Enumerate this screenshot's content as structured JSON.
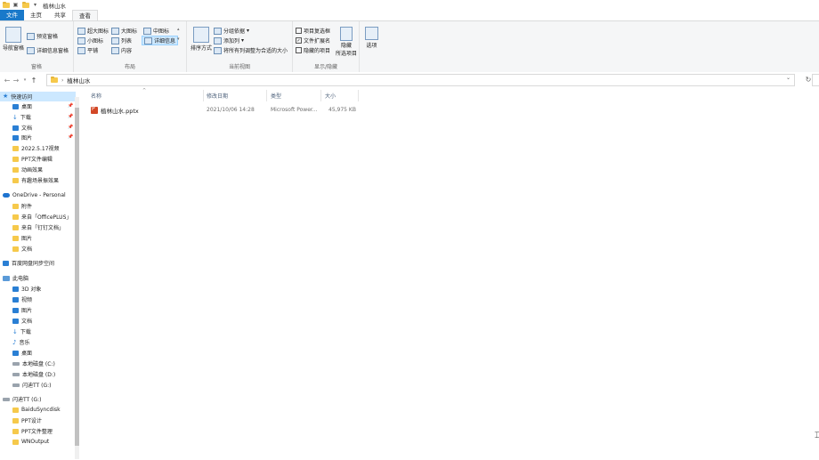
{
  "window": {
    "title": "植林山水"
  },
  "tabs": [
    {
      "label": "文件"
    },
    {
      "label": "主页"
    },
    {
      "label": "共享"
    },
    {
      "label": "查看"
    }
  ],
  "ribbon": {
    "panes": {
      "nav_pane": "导航窗格",
      "preview": "预览窗格",
      "details": "详细信息窗格",
      "label": "窗格"
    },
    "layout": {
      "xl_icons": "超大图标",
      "large_icons": "大图标",
      "medium_icons": "中图标",
      "small_icons": "小图标",
      "list": "列表",
      "details": "详细信息",
      "tiles": "平铺",
      "content": "内容",
      "label": "布局"
    },
    "current_view": {
      "sort": "排序方式",
      "group_by": "分组依据",
      "add_columns": "添加列",
      "size_all": "将所有列调整为合适的大小",
      "label": "当前视图"
    },
    "show_hide": {
      "item_checkboxes": "项目复选框",
      "file_ext": "文件扩展名",
      "hidden_items": "隐藏的项目",
      "hide_selected": "隐藏",
      "hide_selected_2": "所选项目",
      "label": "显示/隐藏",
      "item_checkboxes_checked": false,
      "file_ext_checked": true,
      "hidden_items_checked": false
    },
    "options": "选项"
  },
  "address": {
    "crumb": "植林山水"
  },
  "nav": {
    "items": [
      {
        "label": "快速访问",
        "icon": "star-icon",
        "pinned": false
      },
      {
        "label": "桌面",
        "icon": "desktop-icon",
        "pinned": true
      },
      {
        "label": "下载",
        "icon": "download-icon",
        "pinned": true
      },
      {
        "label": "文档",
        "icon": "documents-icon",
        "pinned": true
      },
      {
        "label": "图片",
        "icon": "pictures-icon",
        "pinned": true
      },
      {
        "label": "2022.5.17视频",
        "icon": "folder-icon",
        "pinned": false
      },
      {
        "label": "PPT文件编辑",
        "icon": "folder-icon",
        "pinned": false
      },
      {
        "label": "动画效果",
        "icon": "folder-icon",
        "pinned": false
      },
      {
        "label": "有趣场景振效果",
        "icon": "folder-icon",
        "pinned": false
      },
      {
        "label": "OneDrive - Personal",
        "icon": "onedrive-icon",
        "pinned": false
      },
      {
        "label": "附件",
        "icon": "folder-icon",
        "pinned": false
      },
      {
        "label": "来自「OfficePLUS」",
        "icon": "folder-icon",
        "pinned": false
      },
      {
        "label": "来自「钉钉文档」",
        "icon": "folder-icon",
        "pinned": false
      },
      {
        "label": "图片",
        "icon": "folder-icon",
        "pinned": false
      },
      {
        "label": "文档",
        "icon": "folder-icon",
        "pinned": false
      },
      {
        "label": "百度网盘同步空间",
        "icon": "baidu-sync-icon",
        "pinned": false
      },
      {
        "label": "此电脑",
        "icon": "this-pc-icon",
        "pinned": false
      },
      {
        "label": "3D 对象",
        "icon": "3d-objects-icon",
        "pinned": false
      },
      {
        "label": "视频",
        "icon": "videos-icon",
        "pinned": false
      },
      {
        "label": "图片",
        "icon": "pictures-icon",
        "pinned": false
      },
      {
        "label": "文档",
        "icon": "documents-icon",
        "pinned": false
      },
      {
        "label": "下载",
        "icon": "download-icon",
        "pinned": false
      },
      {
        "label": "音乐",
        "icon": "music-icon",
        "pinned": false
      },
      {
        "label": "桌面",
        "icon": "desktop-icon",
        "pinned": false
      },
      {
        "label": "本地磁盘 (C:)",
        "icon": "drive-icon",
        "pinned": false
      },
      {
        "label": "本地磁盘 (D:)",
        "icon": "drive-icon",
        "pinned": false
      },
      {
        "label": "闪迪TT (G:)",
        "icon": "usb-drive-icon",
        "pinned": false
      },
      {
        "label": "闪迪TT (G:)",
        "icon": "usb-drive-icon",
        "pinned": false
      },
      {
        "label": "BaiduSyncdisk",
        "icon": "folder-icon",
        "pinned": false
      },
      {
        "label": "PPT设计",
        "icon": "folder-icon",
        "pinned": false
      },
      {
        "label": "PPT文件整理",
        "icon": "folder-icon",
        "pinned": false
      },
      {
        "label": "WNOutput",
        "icon": "folder-icon",
        "pinned": false
      }
    ]
  },
  "columns": {
    "name": "名称",
    "date": "修改日期",
    "type": "类型",
    "size": "大小"
  },
  "files": [
    {
      "name": "植林山水.pptx",
      "date": "2021/10/06 14:28",
      "type": "Microsoft Power...",
      "size": "45,975 KB"
    }
  ],
  "colors": {
    "file_tab": "#1979ca",
    "selection": "#cce8ff"
  }
}
